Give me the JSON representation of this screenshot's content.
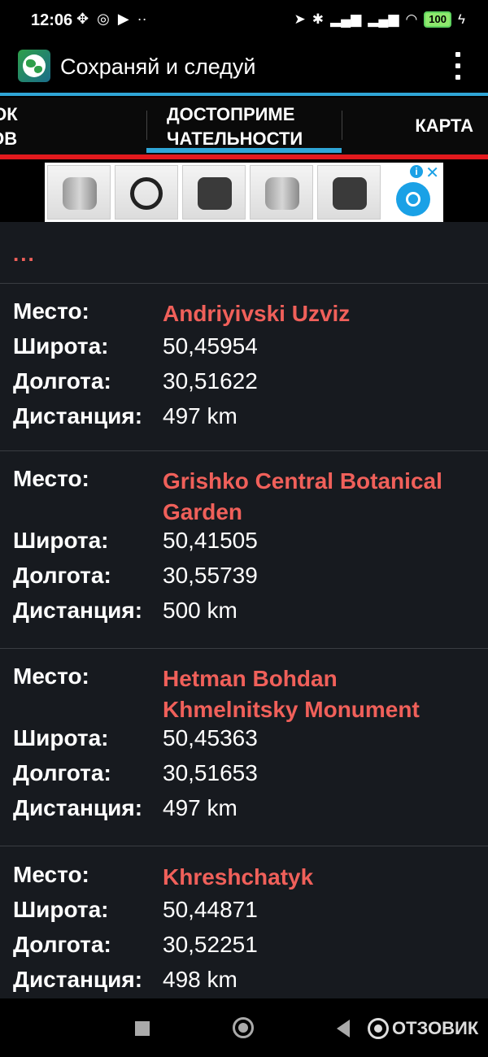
{
  "status_bar": {
    "time": "12:06",
    "battery": "100"
  },
  "app_bar": {
    "title": "Сохраняй и следуй"
  },
  "tabs": [
    {
      "label": "ИСОК\nЕКОВ"
    },
    {
      "label": "ДОСТОПРИМЕ\nЧАТЕЛЬНОСТИ",
      "selected": true
    },
    {
      "label": "КАРТА"
    }
  ],
  "colors": {
    "accent": "#2fa5d6",
    "red_bar": "#e3191d",
    "place_name": "#f0605a",
    "list_bg": "#171a1f"
  },
  "list": {
    "ellipsis": "...",
    "labels": {
      "place": "Место:",
      "lat": "Широта:",
      "lon": "Долгота:",
      "dist": "Дистанция:"
    },
    "entries": [
      {
        "name": "Andriyivski Uzviz",
        "lat": "50,45954",
        "lon": "30,51622",
        "dist": "497 km"
      },
      {
        "name": "Grishko Central Botanical Garden",
        "lat": "50,41505",
        "lon": "30,55739",
        "dist": "500 km"
      },
      {
        "name": "Hetman Bohdan Khmelnitsky Monument",
        "lat": "50,45363",
        "lon": "30,51653",
        "dist": "497 km"
      },
      {
        "name": "Khreshchatyk",
        "lat": "50,44871",
        "lon": "30,52251",
        "dist": "498 km"
      }
    ]
  },
  "watermark": {
    "text": "ОТЗОВИК"
  }
}
